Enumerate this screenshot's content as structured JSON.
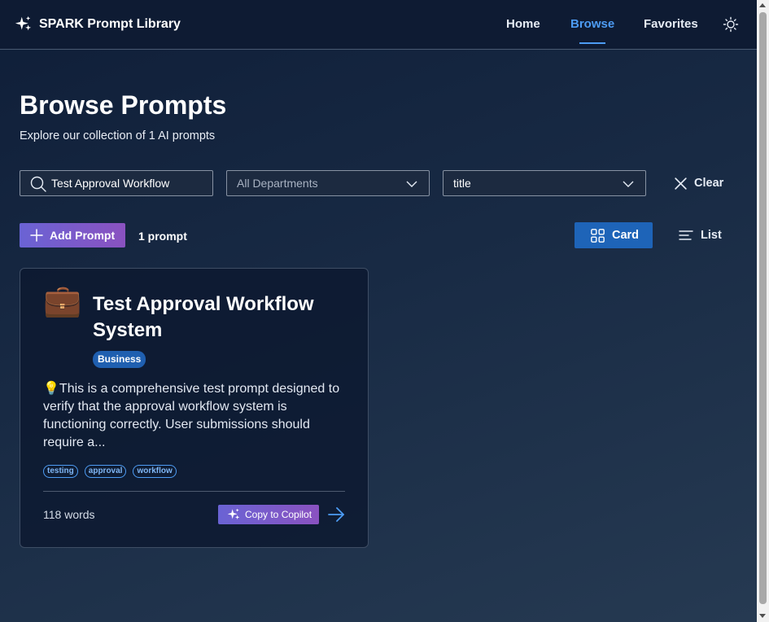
{
  "header": {
    "app_title": "SPARK Prompt Library",
    "nav": [
      {
        "label": "Home",
        "active": false
      },
      {
        "label": "Browse",
        "active": true
      },
      {
        "label": "Favorites",
        "active": false
      }
    ],
    "theme_icon": "sun-icon"
  },
  "page": {
    "title": "Browse Prompts",
    "subtitle": "Explore our collection of 1 AI prompts"
  },
  "filters": {
    "search_value": "Test Approval Workflow",
    "department_placeholder": "All Departments",
    "sort_value": "title",
    "clear_label": "Clear"
  },
  "toolbar": {
    "add_label": "Add Prompt",
    "count_label": "1 prompt",
    "view_card_label": "Card",
    "view_list_label": "List",
    "active_view": "card"
  },
  "prompts": [
    {
      "emoji": "💼",
      "title": "Test Approval Workflow System",
      "department": "Business",
      "description": "💡This is a comprehensive test prompt designed to verify that the approval workflow system is functioning correctly. User submissions should require a...",
      "tags": [
        "testing",
        "approval",
        "workflow"
      ],
      "word_count": "118 words",
      "copy_label": "Copy to Copilot"
    }
  ],
  "colors": {
    "accent": "#4d9cf4",
    "card_view_button": "#1e64b8",
    "badge": "#1f5fb0",
    "gradient_start": "#6a63d4",
    "gradient_end": "#8a52c0"
  }
}
